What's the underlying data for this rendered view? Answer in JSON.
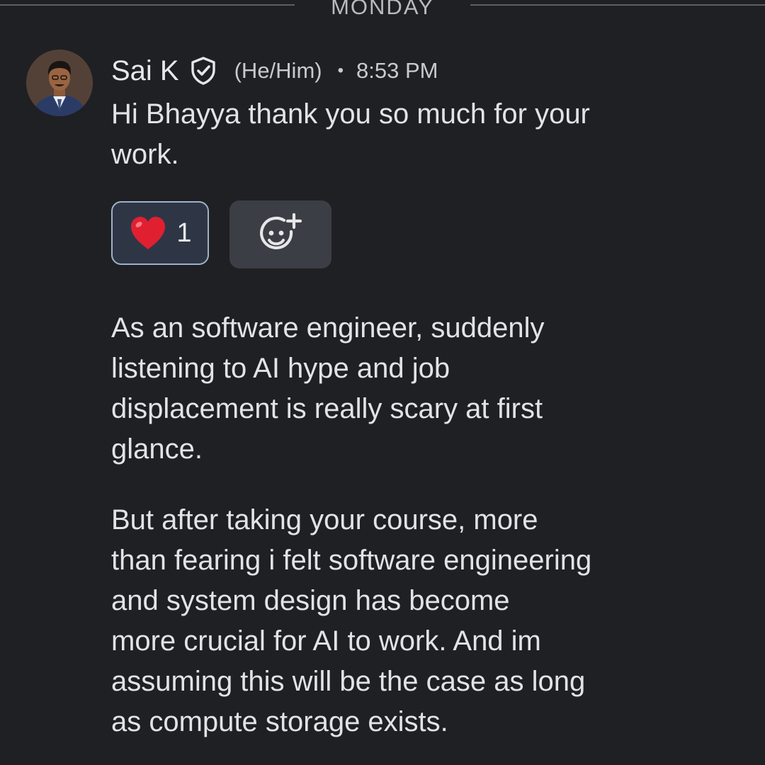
{
  "day_divider": "MONDAY",
  "message": {
    "sender": "Sai K",
    "pronouns": "(He/Him)",
    "separator": "•",
    "time": "8:53 PM",
    "paragraphs": [
      [
        "Hi Bhayya thank you so much for your",
        "work."
      ],
      [
        "As an software engineer, suddenly",
        "listening to AI hype and job",
        "displacement is really scary at first",
        "glance."
      ],
      [
        "But after taking your course, more",
        "than fearing i felt software engineering",
        "and system design has become",
        "more crucial for AI to work. And im",
        "assuming this will be the case as long",
        "as compute storage exists."
      ]
    ]
  },
  "reactions": [
    {
      "emoji": "heart",
      "count": "1",
      "selected": true
    }
  ],
  "icons": {
    "avatar": "avatar",
    "verified": "verified-shield-icon",
    "add_reaction": "add-reaction-icon",
    "heart": "heart-emoji-icon"
  },
  "colors": {
    "background": "#1f2023",
    "text": "#e3e3e6",
    "reaction_border": "#9fb1c8",
    "reaction_bg": "#2e3646",
    "add_reaction_bg": "#3b3e45",
    "heart": "#e02030"
  }
}
